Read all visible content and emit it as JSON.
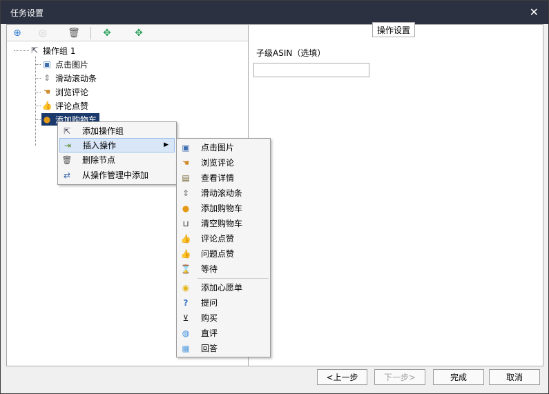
{
  "window": {
    "title": "任务设置",
    "close_glyph": "✕"
  },
  "toolbar": {
    "buttons": [
      {
        "name": "add-circle-icon",
        "glyph": "⊕",
        "color": "#2f7dd3"
      },
      {
        "name": "disabled-circle-icon",
        "glyph": "◎",
        "color": "#c9c9c9"
      },
      {
        "name": "trash-icon",
        "glyph": "🗑",
        "color": "#555555"
      },
      {
        "name": "expand-icon",
        "glyph": "✥",
        "color": "#2aa05a"
      },
      {
        "name": "collapse-icon",
        "glyph": "✥",
        "color": "#2aa05a"
      }
    ]
  },
  "tree": {
    "root": {
      "label": "操作组 1",
      "icon": "cursor-icon"
    },
    "children": [
      {
        "label": "点击图片",
        "icon": "image-icon"
      },
      {
        "label": "滑动滚动条",
        "icon": "scroll-icon"
      },
      {
        "label": "浏览评论",
        "icon": "hand-icon"
      },
      {
        "label": "评论点赞",
        "icon": "thumbs-up-icon"
      },
      {
        "label": "添加购物车",
        "icon": "cart-add-icon",
        "selected": true
      }
    ]
  },
  "right": {
    "group_title": "操作设置",
    "field_label": "子级ASIN（选填）",
    "field_value": ""
  },
  "context_menu": {
    "items": [
      {
        "label": "添加操作组",
        "icon": "cursor-icon"
      },
      {
        "label": "插入操作",
        "icon": "insert-icon",
        "submenu": true,
        "highlighted": true
      },
      {
        "label": "删除节点",
        "icon": "trash-icon"
      },
      {
        "label": "从操作管理中添加",
        "icon": "import-icon"
      }
    ]
  },
  "submenu": {
    "items": [
      {
        "label": "点击图片",
        "icon": "image-icon"
      },
      {
        "label": "浏览评论",
        "icon": "hand-icon"
      },
      {
        "label": "查看详情",
        "icon": "detail-icon"
      },
      {
        "label": "滑动滚动条",
        "icon": "scroll-icon"
      },
      {
        "label": "添加购物车",
        "icon": "cart-add-icon"
      },
      {
        "label": "清空购物车",
        "icon": "cart-empty-icon"
      },
      {
        "label": "评论点赞",
        "icon": "thumbs-up-icon"
      },
      {
        "label": "问题点赞",
        "icon": "thumbs-up-icon"
      },
      {
        "label": "等待",
        "icon": "hourglass-icon"
      },
      {
        "label": "添加心愿单",
        "icon": "wishlist-icon"
      },
      {
        "label": "提问",
        "icon": "question-icon"
      },
      {
        "label": "购买",
        "icon": "buy-cart-icon"
      },
      {
        "label": "直评",
        "icon": "comment-icon"
      },
      {
        "label": "回答",
        "icon": "answer-icon"
      }
    ]
  },
  "footer": {
    "prev": "<上一步",
    "next": "下一步>",
    "finish": "完成",
    "cancel": "取消"
  }
}
